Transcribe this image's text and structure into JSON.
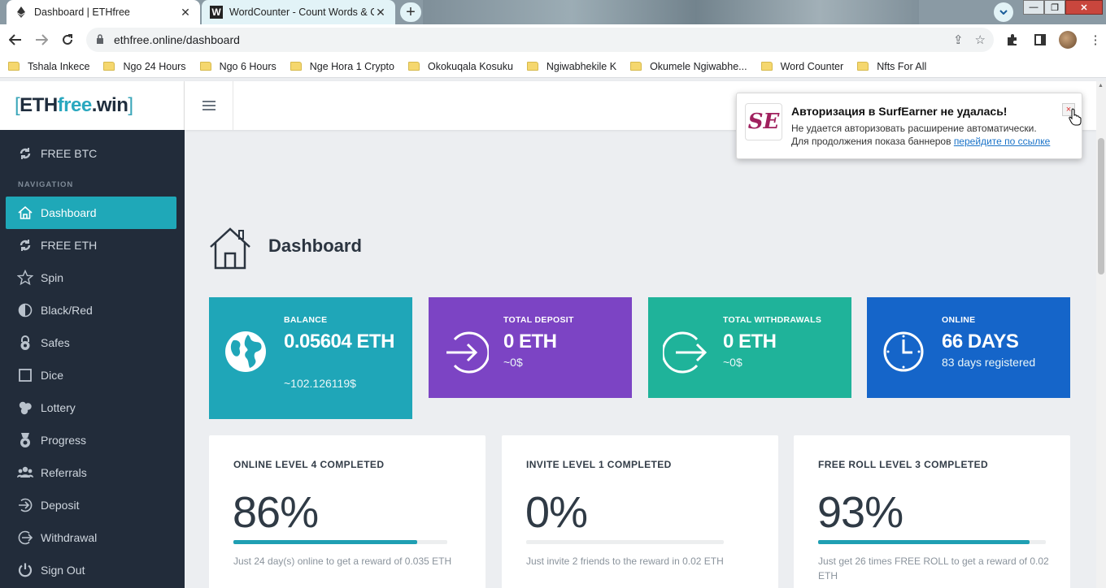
{
  "browser": {
    "tabs": [
      {
        "title": "Dashboard | ETHfree",
        "favicon": "ethereum-icon"
      },
      {
        "title": "WordCounter - Count Words & C",
        "favicon": "W"
      }
    ],
    "url": "ethfree.online/dashboard",
    "bookmarks": [
      "Tshala Inkece",
      "Ngo 24 Hours",
      "Ngo 6 Hours",
      "Nge Hora 1 Crypto",
      "Okokuqala Kosuku",
      "Ngiwabhekile K",
      "Okumele Ngiwabhe...",
      "Word Counter",
      "Nfts For All"
    ]
  },
  "site": {
    "logo": {
      "bracket_open": "[",
      "eth": "ETH",
      "free": "free",
      "win": ".win",
      "bracket_close": "]"
    }
  },
  "sidebar": {
    "free_btc": "FREE BTC",
    "nav_label": "NAVIGATION",
    "items": [
      {
        "label": "Dashboard",
        "icon": "home-icon"
      },
      {
        "label": "FREE ETH",
        "icon": "refresh-icon"
      },
      {
        "label": "Spin",
        "icon": "star-icon"
      },
      {
        "label": "Black/Red",
        "icon": "half-circle-icon"
      },
      {
        "label": "Safes",
        "icon": "padlock-icon"
      },
      {
        "label": "Dice",
        "icon": "square-icon"
      },
      {
        "label": "Lottery",
        "icon": "balls-icon"
      },
      {
        "label": "Progress",
        "icon": "medal-icon"
      },
      {
        "label": "Referrals",
        "icon": "users-icon"
      },
      {
        "label": "Deposit",
        "icon": "arrow-in-icon"
      },
      {
        "label": "Withdrawal",
        "icon": "arrow-out-icon"
      },
      {
        "label": "Sign Out",
        "icon": "power-icon"
      }
    ]
  },
  "main": {
    "title": "Dashboard",
    "stats": [
      {
        "label": "BALANCE",
        "value": "0.05604 ETH",
        "sub": "~102.126119$",
        "color": "#1fa6b8",
        "icon": "globe-icon"
      },
      {
        "label": "TOTAL DEPOSIT",
        "value": "0 ETH",
        "sub": "~0$",
        "color": "#7c44c4",
        "icon": "deposit-icon"
      },
      {
        "label": "TOTAL WITHDRAWALS",
        "value": "0 ETH",
        "sub": "~0$",
        "color": "#1fb39a",
        "icon": "withdraw-icon"
      },
      {
        "label": "ONLINE",
        "value": "66 DAYS",
        "sub": "83 days registered",
        "color": "#1565c9",
        "icon": "clock-icon"
      }
    ],
    "levels": [
      {
        "title": "ONLINE LEVEL 4 COMPLETED",
        "percent": "86%",
        "progress": 0.86,
        "desc": "Just 24 day(s) online to get a reward of 0.035 ETH"
      },
      {
        "title": "INVITE LEVEL 1 COMPLETED",
        "percent": "0%",
        "progress": 0,
        "desc": "Just invite 2 friends to the reward in 0.02 ETH"
      },
      {
        "title": "FREE ROLL LEVEL 3 COMPLETED",
        "percent": "93%",
        "progress": 0.93,
        "desc": "Just get 26 times FREE ROLL to get a reward of 0.02 ETH"
      }
    ]
  },
  "notification": {
    "logo": "SE",
    "title": "Авторизация в SurfEarner не удалась!",
    "line1": "Не удается авторизовать расширение автоматически.",
    "line2": "Для продолжения показа баннеров ",
    "link": "перейдите по ссылке",
    "close": "×"
  }
}
